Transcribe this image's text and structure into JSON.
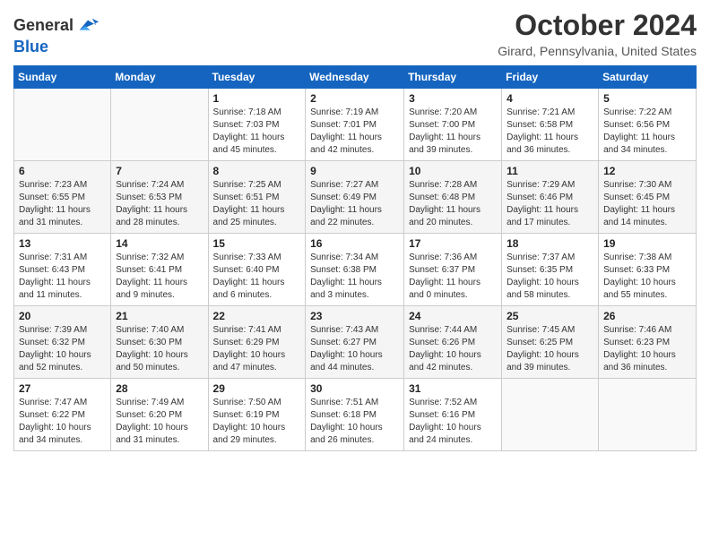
{
  "header": {
    "logo_line1": "General",
    "logo_line2": "Blue",
    "month_title": "October 2024",
    "location": "Girard, Pennsylvania, United States"
  },
  "weekdays": [
    "Sunday",
    "Monday",
    "Tuesday",
    "Wednesday",
    "Thursday",
    "Friday",
    "Saturday"
  ],
  "weeks": [
    [
      {
        "day": "",
        "info": ""
      },
      {
        "day": "",
        "info": ""
      },
      {
        "day": "1",
        "info": "Sunrise: 7:18 AM\nSunset: 7:03 PM\nDaylight: 11 hours and 45 minutes."
      },
      {
        "day": "2",
        "info": "Sunrise: 7:19 AM\nSunset: 7:01 PM\nDaylight: 11 hours and 42 minutes."
      },
      {
        "day": "3",
        "info": "Sunrise: 7:20 AM\nSunset: 7:00 PM\nDaylight: 11 hours and 39 minutes."
      },
      {
        "day": "4",
        "info": "Sunrise: 7:21 AM\nSunset: 6:58 PM\nDaylight: 11 hours and 36 minutes."
      },
      {
        "day": "5",
        "info": "Sunrise: 7:22 AM\nSunset: 6:56 PM\nDaylight: 11 hours and 34 minutes."
      }
    ],
    [
      {
        "day": "6",
        "info": "Sunrise: 7:23 AM\nSunset: 6:55 PM\nDaylight: 11 hours and 31 minutes."
      },
      {
        "day": "7",
        "info": "Sunrise: 7:24 AM\nSunset: 6:53 PM\nDaylight: 11 hours and 28 minutes."
      },
      {
        "day": "8",
        "info": "Sunrise: 7:25 AM\nSunset: 6:51 PM\nDaylight: 11 hours and 25 minutes."
      },
      {
        "day": "9",
        "info": "Sunrise: 7:27 AM\nSunset: 6:49 PM\nDaylight: 11 hours and 22 minutes."
      },
      {
        "day": "10",
        "info": "Sunrise: 7:28 AM\nSunset: 6:48 PM\nDaylight: 11 hours and 20 minutes."
      },
      {
        "day": "11",
        "info": "Sunrise: 7:29 AM\nSunset: 6:46 PM\nDaylight: 11 hours and 17 minutes."
      },
      {
        "day": "12",
        "info": "Sunrise: 7:30 AM\nSunset: 6:45 PM\nDaylight: 11 hours and 14 minutes."
      }
    ],
    [
      {
        "day": "13",
        "info": "Sunrise: 7:31 AM\nSunset: 6:43 PM\nDaylight: 11 hours and 11 minutes."
      },
      {
        "day": "14",
        "info": "Sunrise: 7:32 AM\nSunset: 6:41 PM\nDaylight: 11 hours and 9 minutes."
      },
      {
        "day": "15",
        "info": "Sunrise: 7:33 AM\nSunset: 6:40 PM\nDaylight: 11 hours and 6 minutes."
      },
      {
        "day": "16",
        "info": "Sunrise: 7:34 AM\nSunset: 6:38 PM\nDaylight: 11 hours and 3 minutes."
      },
      {
        "day": "17",
        "info": "Sunrise: 7:36 AM\nSunset: 6:37 PM\nDaylight: 11 hours and 0 minutes."
      },
      {
        "day": "18",
        "info": "Sunrise: 7:37 AM\nSunset: 6:35 PM\nDaylight: 10 hours and 58 minutes."
      },
      {
        "day": "19",
        "info": "Sunrise: 7:38 AM\nSunset: 6:33 PM\nDaylight: 10 hours and 55 minutes."
      }
    ],
    [
      {
        "day": "20",
        "info": "Sunrise: 7:39 AM\nSunset: 6:32 PM\nDaylight: 10 hours and 52 minutes."
      },
      {
        "day": "21",
        "info": "Sunrise: 7:40 AM\nSunset: 6:30 PM\nDaylight: 10 hours and 50 minutes."
      },
      {
        "day": "22",
        "info": "Sunrise: 7:41 AM\nSunset: 6:29 PM\nDaylight: 10 hours and 47 minutes."
      },
      {
        "day": "23",
        "info": "Sunrise: 7:43 AM\nSunset: 6:27 PM\nDaylight: 10 hours and 44 minutes."
      },
      {
        "day": "24",
        "info": "Sunrise: 7:44 AM\nSunset: 6:26 PM\nDaylight: 10 hours and 42 minutes."
      },
      {
        "day": "25",
        "info": "Sunrise: 7:45 AM\nSunset: 6:25 PM\nDaylight: 10 hours and 39 minutes."
      },
      {
        "day": "26",
        "info": "Sunrise: 7:46 AM\nSunset: 6:23 PM\nDaylight: 10 hours and 36 minutes."
      }
    ],
    [
      {
        "day": "27",
        "info": "Sunrise: 7:47 AM\nSunset: 6:22 PM\nDaylight: 10 hours and 34 minutes."
      },
      {
        "day": "28",
        "info": "Sunrise: 7:49 AM\nSunset: 6:20 PM\nDaylight: 10 hours and 31 minutes."
      },
      {
        "day": "29",
        "info": "Sunrise: 7:50 AM\nSunset: 6:19 PM\nDaylight: 10 hours and 29 minutes."
      },
      {
        "day": "30",
        "info": "Sunrise: 7:51 AM\nSunset: 6:18 PM\nDaylight: 10 hours and 26 minutes."
      },
      {
        "day": "31",
        "info": "Sunrise: 7:52 AM\nSunset: 6:16 PM\nDaylight: 10 hours and 24 minutes."
      },
      {
        "day": "",
        "info": ""
      },
      {
        "day": "",
        "info": ""
      }
    ]
  ]
}
